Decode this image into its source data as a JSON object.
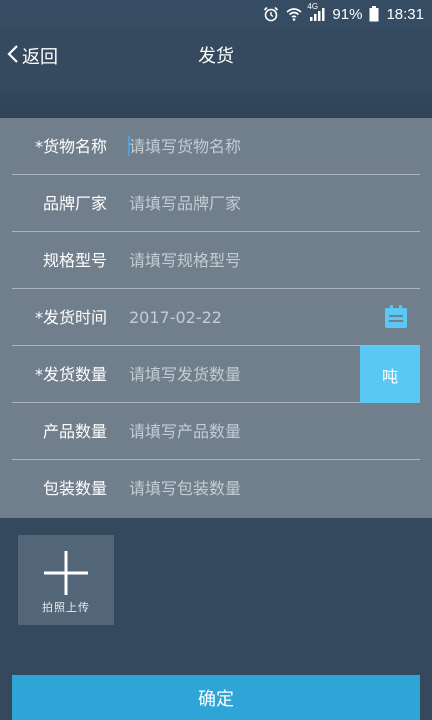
{
  "status_bar": {
    "network": "4G",
    "battery": "91%",
    "time": "18:31"
  },
  "header": {
    "back_label": "返回",
    "title": "发货"
  },
  "form": {
    "rows": [
      {
        "label": "*货物名称",
        "placeholder": "请填写货物名称"
      },
      {
        "label": "品牌厂家",
        "placeholder": "请填写品牌厂家"
      },
      {
        "label": "规格型号",
        "placeholder": "请填写规格型号"
      },
      {
        "label": "*发货时间",
        "value": "2017-02-22"
      },
      {
        "label": "*发货数量",
        "placeholder": "请填写发货数量",
        "unit": "吨"
      },
      {
        "label": "产品数量",
        "placeholder": "请填写产品数量"
      },
      {
        "label": "包装数量",
        "placeholder": "请填写包装数量"
      }
    ]
  },
  "upload": {
    "label": "拍照上传"
  },
  "confirm": {
    "label": "确定"
  },
  "colors": {
    "background": "#34495e",
    "form_background": "#717f8c",
    "accent": "#5ac8f5",
    "button": "#2ea4d7"
  }
}
